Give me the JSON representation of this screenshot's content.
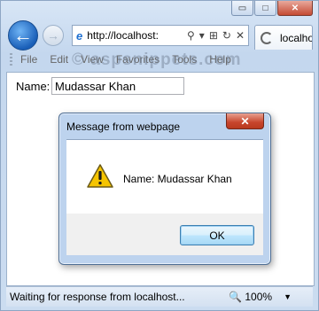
{
  "browser": {
    "title_controls": {
      "minimize": "▭",
      "maximize": "□",
      "close": "✕"
    },
    "nav": {
      "back": "←",
      "forward": "→"
    },
    "address": {
      "ie_logo": "e",
      "url": "http://localhost:",
      "tools": [
        "⚲",
        "▾",
        "⊞",
        "↻",
        "✕"
      ]
    },
    "tab": {
      "label": "localhost"
    },
    "menu": [
      "File",
      "Edit",
      "View",
      "Favorites",
      "Tools",
      "Help"
    ],
    "watermark": "© aspsnippets.com"
  },
  "page": {
    "name_label": "Name:",
    "name_value": "Mudassar Khan"
  },
  "dialog": {
    "title": "Message from webpage",
    "close": "✕",
    "message": "Name: Mudassar Khan",
    "ok_label": "OK"
  },
  "statusbar": {
    "text": "Waiting for response from localhost...",
    "zoom_icon": "🔍",
    "zoom": "100%",
    "zoom_arrow": "▼"
  },
  "colors": {
    "accent": "#1a5fb8",
    "dialog_frame": "#bdd3ee",
    "close_red": "#c7452c",
    "warning_yellow": "#f5c400"
  },
  "icons": [
    "back-icon",
    "forward-icon",
    "ie-logo-icon",
    "search-icon",
    "refresh-icon",
    "stop-icon",
    "loading-icon",
    "warning-icon",
    "zoom-icon"
  ]
}
